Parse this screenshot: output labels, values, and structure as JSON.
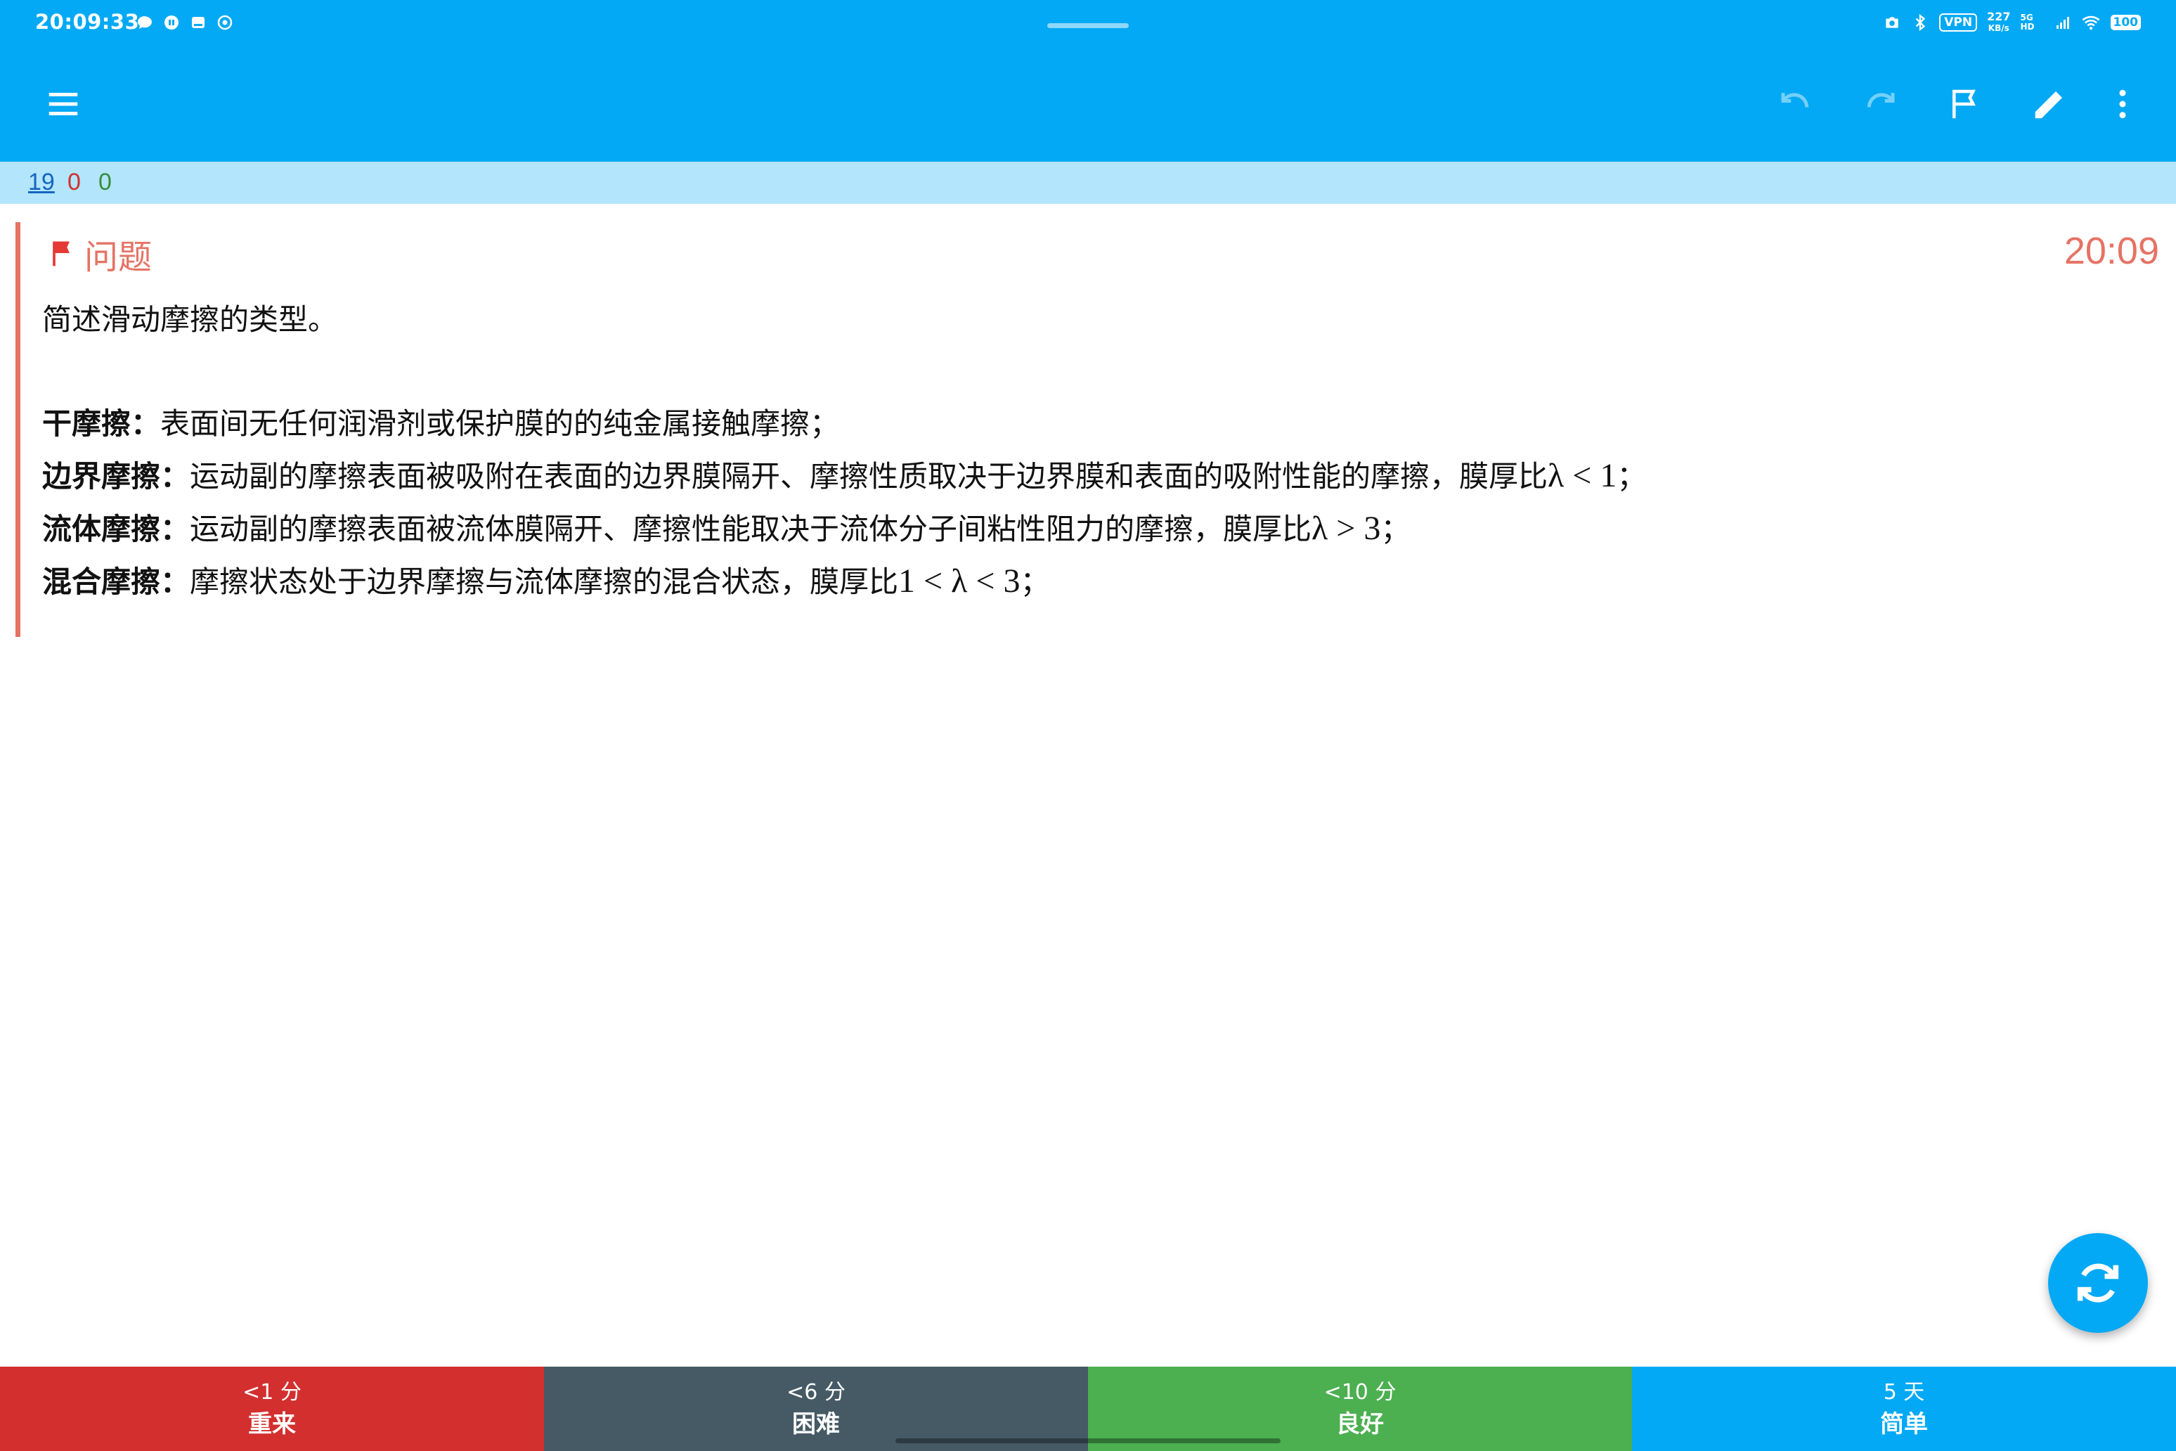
{
  "status_bar": {
    "time": "20:09:33",
    "vpn": "VPN",
    "net_speed": "227",
    "net_unit": "KB/s",
    "net_type": "5G HD",
    "battery": "100"
  },
  "toolbar": {
    "menu_icon": "menu-icon",
    "undo_icon": "undo-icon",
    "redo_icon": "redo-icon",
    "flag_icon": "flag-icon",
    "edit_icon": "pencil-icon",
    "more_icon": "more-vert-icon"
  },
  "counts": {
    "new": "19",
    "learning": "0",
    "review": "0"
  },
  "card": {
    "header_label": "问题",
    "timer": "20:09",
    "question": "简述滑动摩擦的类型。",
    "answers": [
      {
        "term": "干摩擦：",
        "text": "表面间无任何润滑剂或保护膜的的纯金属接触摩擦；",
        "math": "",
        "tail": ""
      },
      {
        "term": "边界摩擦：",
        "text": "运动副的摩擦表面被吸附在表面的边界膜隔开、摩擦性质取决于边界膜和表面的吸附性能的摩擦，膜厚比",
        "math": "λ < 1",
        "tail": "；"
      },
      {
        "term": "流体摩擦：",
        "text": "运动副的摩擦表面被流体膜隔开、摩擦性能取决于流体分子间粘性阻力的摩擦，膜厚比",
        "math": "λ > 3",
        "tail": "；"
      },
      {
        "term": "混合摩擦：",
        "text": "摩擦状态处于边界摩擦与流体摩擦的混合状态，膜厚比",
        "math": "1 < λ < 3",
        "tail": "；"
      }
    ]
  },
  "fab": {
    "icon": "sync-icon"
  },
  "answer_buttons": [
    {
      "interval": "<1 分",
      "label": "重来",
      "color": "#D32F2F"
    },
    {
      "interval": "<6 分",
      "label": "困难",
      "color": "#455A64"
    },
    {
      "interval": "<10 分",
      "label": "良好",
      "color": "#4CAF50"
    },
    {
      "interval": "5 天",
      "label": "简单",
      "color": "#03A9F4"
    }
  ],
  "colors": {
    "primary": "#03A9F4",
    "accent_red": "#E57364"
  }
}
